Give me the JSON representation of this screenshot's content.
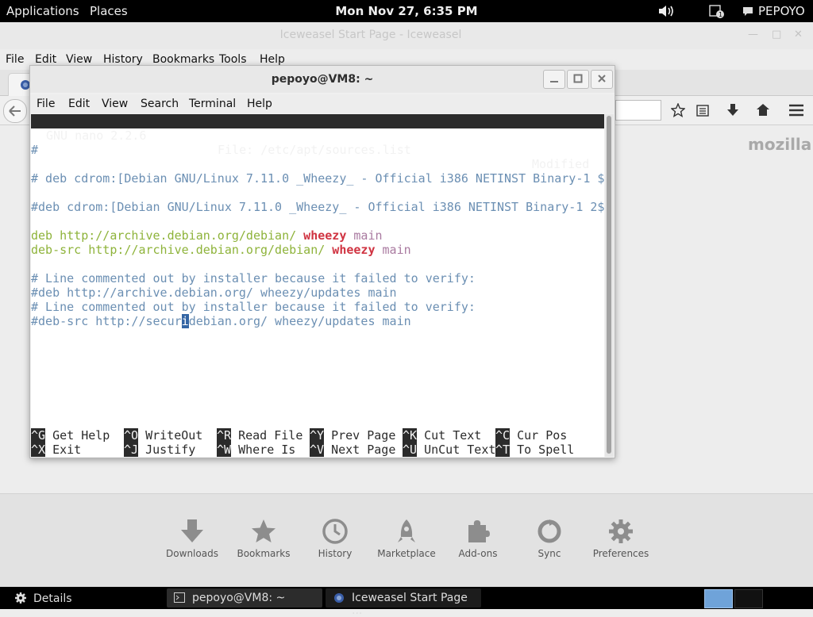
{
  "topbar": {
    "applications": "Applications",
    "places": "Places",
    "clock": "Mon Nov 27,  6:35 PM",
    "user": "PEPOYO",
    "icons": [
      "volume-icon",
      "notification-icon",
      "chat-icon"
    ]
  },
  "browser": {
    "window_title": "Iceweasel Start Page - Iceweasel",
    "menu": [
      "File",
      "Edit",
      "View",
      "History",
      "Bookmarks",
      "Tools",
      "Help"
    ],
    "logo": "mozilla",
    "launcher": [
      {
        "label": "Downloads",
        "icon": "download-icon"
      },
      {
        "label": "Bookmarks",
        "icon": "star-icon"
      },
      {
        "label": "History",
        "icon": "clock-icon"
      },
      {
        "label": "Marketplace",
        "icon": "rocket-icon"
      },
      {
        "label": "Add-ons",
        "icon": "puzzle-icon"
      },
      {
        "label": "Sync",
        "icon": "sync-icon"
      },
      {
        "label": "Preferences",
        "icon": "gear-icon"
      }
    ]
  },
  "terminal": {
    "title": "pepoyo@VM8: ~",
    "menu": [
      "File",
      "Edit",
      "View",
      "Search",
      "Terminal",
      "Help"
    ],
    "nano": {
      "version": "GNU nano 2.2.6",
      "file": "File: /etc/apt/sources.list",
      "status": "Modified",
      "lines": {
        "l1": "#",
        "l2": "# deb cdrom:[Debian GNU/Linux 7.11.0 _Wheezy_ - Official i386 NETINST Binary-1 $",
        "l3": "#deb cdrom:[Debian GNU/Linux 7.11.0 _Wheezy_ - Official i386 NETINST Binary-1 2$",
        "l4_kw": "deb",
        "l4_url": "http://archive.debian.org/debian/",
        "l4_dist": "wheezy",
        "l4_comp": "main",
        "l5_kw": "deb-src",
        "l5_url": "http://archive.debian.org/debian/",
        "l5_dist": "wheezy",
        "l5_comp": "main",
        "l6": "# Line commented out by installer because it failed to verify:",
        "l7": "#deb http://archive.debian.org/ wheezy/updates main",
        "l8": "# Line commented out by installer because it failed to verify:",
        "l9_before": "#deb-src http://secur",
        "l9_cursor": "i",
        "l9_after": "debian.org/ wheezy/updates main"
      },
      "shortcuts": [
        {
          "key": "^G",
          "label": "Get Help"
        },
        {
          "key": "^O",
          "label": "WriteOut"
        },
        {
          "key": "^R",
          "label": "Read File"
        },
        {
          "key": "^Y",
          "label": "Prev Page"
        },
        {
          "key": "^K",
          "label": "Cut Text"
        },
        {
          "key": "^C",
          "label": "Cur Pos"
        },
        {
          "key": "^X",
          "label": "Exit"
        },
        {
          "key": "^J",
          "label": "Justify"
        },
        {
          "key": "^W",
          "label": "Where Is"
        },
        {
          "key": "^V",
          "label": "Next Page"
        },
        {
          "key": "^U",
          "label": "UnCut Text"
        },
        {
          "key": "^T",
          "label": "To Spell"
        }
      ]
    }
  },
  "taskbar": {
    "details": "Details",
    "tasks": [
      "pepoyo@VM8: ~",
      "Iceweasel Start Page ..."
    ]
  }
}
